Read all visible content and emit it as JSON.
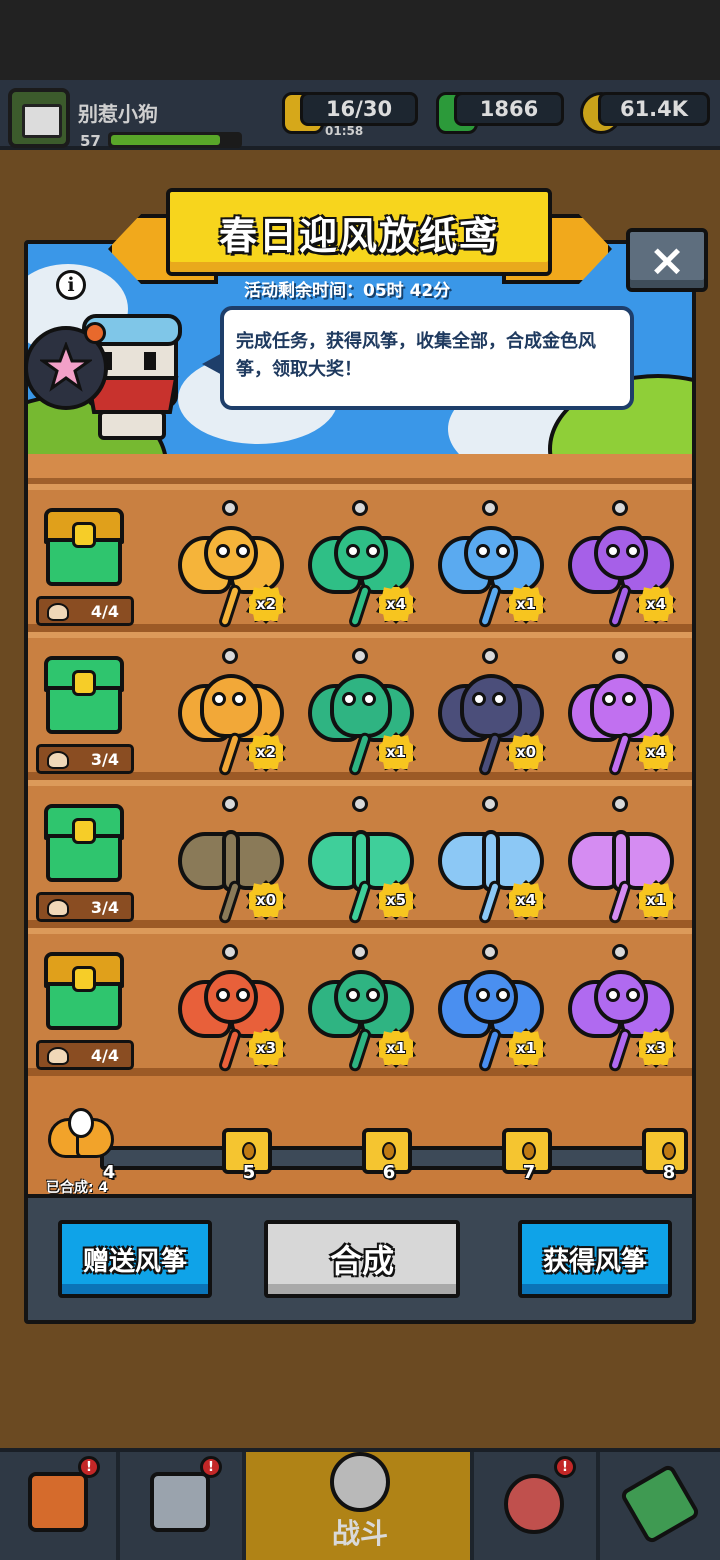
{
  "hud": {
    "player_name": "别惹小狗",
    "level": "57",
    "xp_fraction": 0.85,
    "energy": "16/30",
    "energy_timer": "01:58",
    "gems": "1866",
    "coins": "61.4K"
  },
  "modal": {
    "title": "春日迎风放纸鸢",
    "close_label": "×",
    "info_label": "i",
    "timer_text": "活动剩余时间：05时 42分",
    "description": "完成任务，获得风筝，收集全部，合成金色风筝，领取大奖！"
  },
  "rows": [
    {
      "kind": "cat",
      "progress": "4/4",
      "chest_color": "#e0a01b",
      "kites": [
        {
          "color": "#f5b43a",
          "count": "x2"
        },
        {
          "color": "#2fbf86",
          "count": "x4"
        },
        {
          "color": "#5aaaf0",
          "count": "x1"
        },
        {
          "color": "#a660e8",
          "count": "x4"
        }
      ]
    },
    {
      "kind": "ladybug",
      "progress": "3/4",
      "chest_color": "#2fc56e",
      "kites": [
        {
          "color": "#f2a838",
          "count": "x2"
        },
        {
          "color": "#2fb482",
          "count": "x1"
        },
        {
          "color": "#4b4e7a",
          "count": "x0"
        },
        {
          "color": "#c170f0",
          "count": "x4"
        }
      ]
    },
    {
      "kind": "butterfly",
      "progress": "3/4",
      "chest_color": "#2fc56e",
      "kites": [
        {
          "color": "#8a7a58",
          "count": "x0"
        },
        {
          "color": "#3fcf9a",
          "count": "x5"
        },
        {
          "color": "#8cc8f5",
          "count": "x4"
        },
        {
          "color": "#d58cf2",
          "count": "x1"
        }
      ]
    },
    {
      "kind": "bird",
      "progress": "4/4",
      "chest_color": "#e0a01b",
      "kites": [
        {
          "color": "#e8603a",
          "count": "x3"
        },
        {
          "color": "#2fb482",
          "count": "x1"
        },
        {
          "color": "#4a8ff0",
          "count": "x1"
        },
        {
          "color": "#b06af0",
          "count": "x3"
        }
      ]
    }
  ],
  "synth": {
    "current": "4",
    "label": "已合成: 4",
    "milestones": [
      "5",
      "6",
      "7",
      "8"
    ]
  },
  "buttons": {
    "gift": "赠送风筝",
    "combine": "合成",
    "get": "获得风筝"
  },
  "nav": {
    "battle": "战斗",
    "badges": [
      "!",
      "!",
      "!",
      "!"
    ]
  },
  "colors": {
    "accent_yellow": "#f7d51d",
    "button_blue": "#0fa3e8",
    "shelf_wood": "#c98041",
    "sky": "#3a97e8"
  },
  "icons": {
    "close": "close-icon",
    "info": "info-icon",
    "energy": "lightning-icon",
    "gem": "gem-icon",
    "coin": "coin-icon"
  }
}
